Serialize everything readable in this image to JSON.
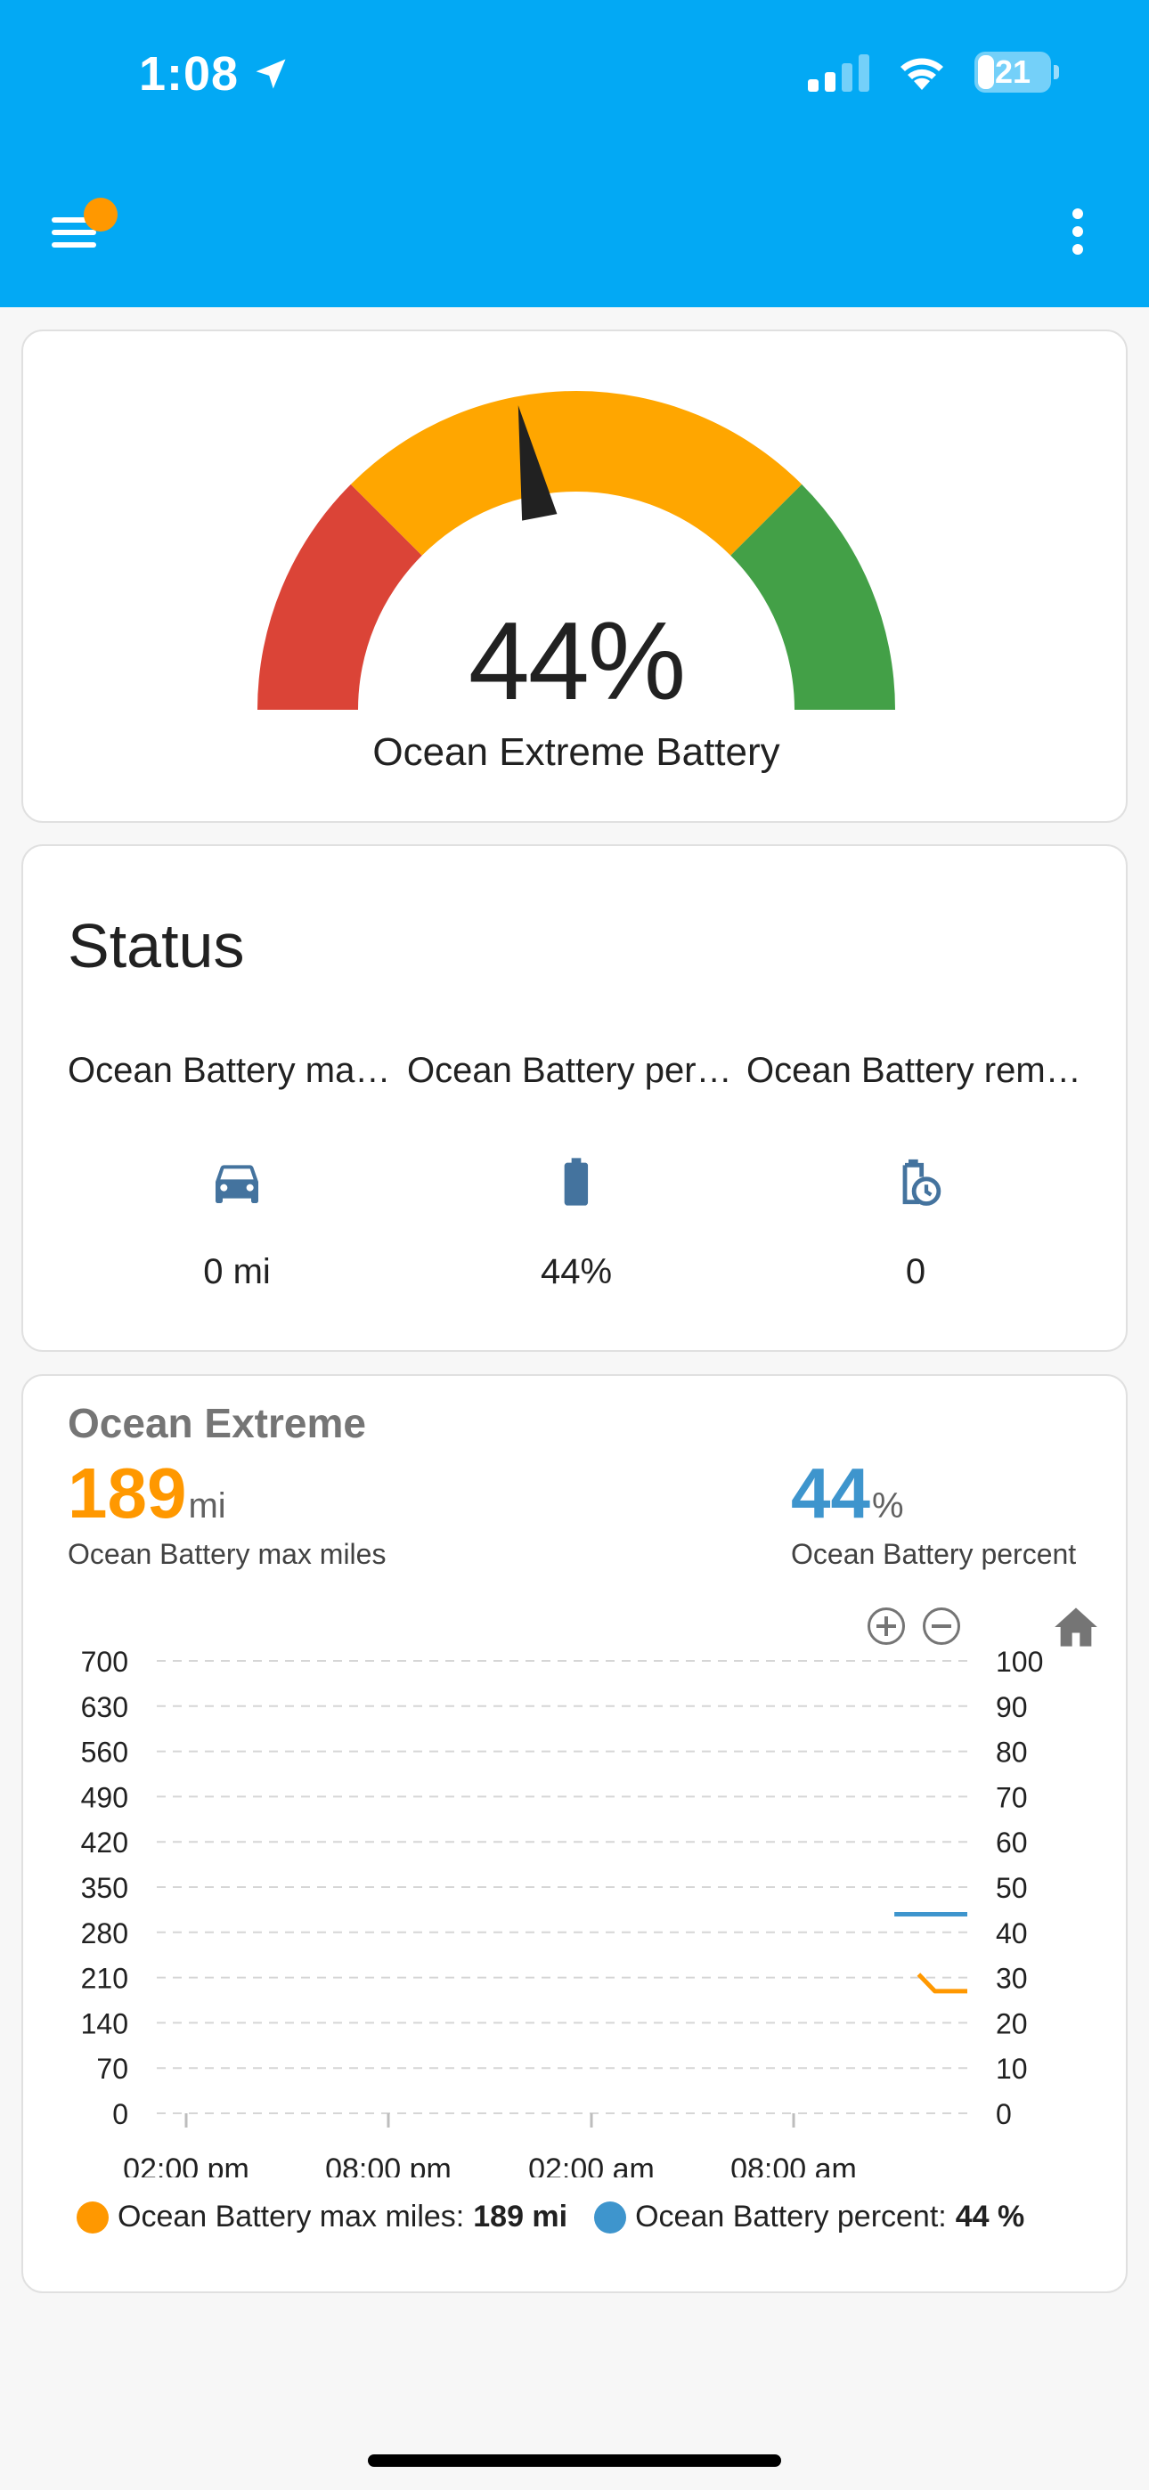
{
  "status_bar": {
    "time": "1:08",
    "battery_level": "21"
  },
  "colors": {
    "app_bar": "#03a9f4",
    "gauge_red": "#db4437",
    "gauge_orange": "#ffa600",
    "gauge_green": "#43a047",
    "series_orange": "#ff9800",
    "series_blue": "#3e95cd",
    "entity_icon": "#44739e"
  },
  "gauge": {
    "value": "44%",
    "value_number": 44,
    "min": 0,
    "max": 100,
    "name": "Ocean Extreme Battery",
    "segments": [
      {
        "from": 0,
        "to": 25,
        "color": "#db4437"
      },
      {
        "from": 25,
        "to": 75,
        "color": "#ffa600"
      },
      {
        "from": 75,
        "to": 100,
        "color": "#43a047"
      }
    ]
  },
  "status_card": {
    "title": "Status",
    "entities": [
      {
        "name": "Ocean Battery max miles",
        "icon": "car-icon",
        "value": "0 mi"
      },
      {
        "name": "Ocean Battery percent",
        "icon": "battery-icon",
        "value": "44%"
      },
      {
        "name": "Ocean Battery remaining time",
        "icon": "battery-clock-icon",
        "value": "0"
      }
    ]
  },
  "graph_card": {
    "title": "Ocean Extreme",
    "primary": {
      "value": "189",
      "unit": "mi",
      "label": "Ocean Battery max miles"
    },
    "secondary": {
      "value": "44",
      "unit": "%",
      "label": "Ocean Battery percent"
    },
    "legend": [
      {
        "name": "Ocean Battery max miles:",
        "value": "189 mi"
      },
      {
        "name": "Ocean Battery percent:",
        "value": "44 %"
      }
    ]
  },
  "chart_data": {
    "type": "line",
    "x_labels": [
      "02:00 pm",
      "08:00 pm",
      "02:00 am",
      "08:00 am"
    ],
    "y_left": {
      "ticks": [
        "700",
        "630",
        "560",
        "490",
        "420",
        "350",
        "280",
        "210",
        "140",
        "70",
        "0"
      ],
      "range": [
        0,
        700
      ]
    },
    "y_right": {
      "ticks": [
        "100",
        "90",
        "80",
        "70",
        "60",
        "50",
        "40",
        "30",
        "20",
        "10",
        "0"
      ],
      "range": [
        0,
        100
      ]
    },
    "grid": true,
    "series": [
      {
        "name": "Ocean Battery max miles",
        "axis": "left",
        "color": "#ff9800",
        "points": [
          [
            0.94,
            215
          ],
          [
            0.96,
            189
          ],
          [
            1.0,
            189
          ]
        ]
      },
      {
        "name": "Ocean Battery percent",
        "axis": "right",
        "color": "#3e95cd",
        "points": [
          [
            0.91,
            44
          ],
          [
            1.0,
            44
          ]
        ]
      }
    ]
  }
}
